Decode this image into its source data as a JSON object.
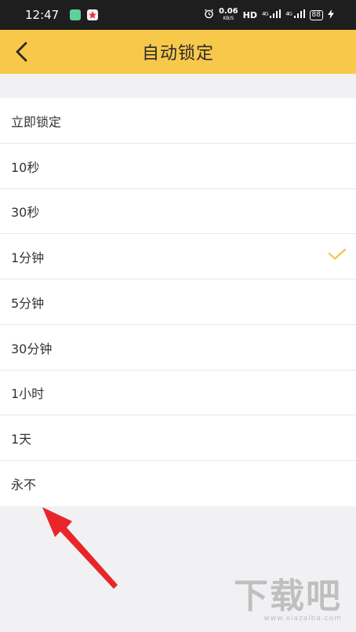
{
  "status_bar": {
    "time": "12:47",
    "network_speed_value": "0.06",
    "network_speed_unit": "KB/S",
    "hd_label": "HD",
    "signal_1": "⁴ᴳ",
    "signal_2": "⁴ᴳ",
    "battery": "88"
  },
  "nav": {
    "title": "自动锁定"
  },
  "options": [
    {
      "label": "立即锁定",
      "selected": false
    },
    {
      "label": "10秒",
      "selected": false
    },
    {
      "label": "30秒",
      "selected": false
    },
    {
      "label": "1分钟",
      "selected": true
    },
    {
      "label": "5分钟",
      "selected": false
    },
    {
      "label": "30分钟",
      "selected": false
    },
    {
      "label": "1小时",
      "selected": false
    },
    {
      "label": "1天",
      "selected": false
    },
    {
      "label": "永不",
      "selected": false
    }
  ],
  "colors": {
    "accent": "#f8c84a",
    "arrow": "#e8262a"
  },
  "watermark": {
    "text": "下载吧",
    "url": "www.xiazaiba.com"
  }
}
